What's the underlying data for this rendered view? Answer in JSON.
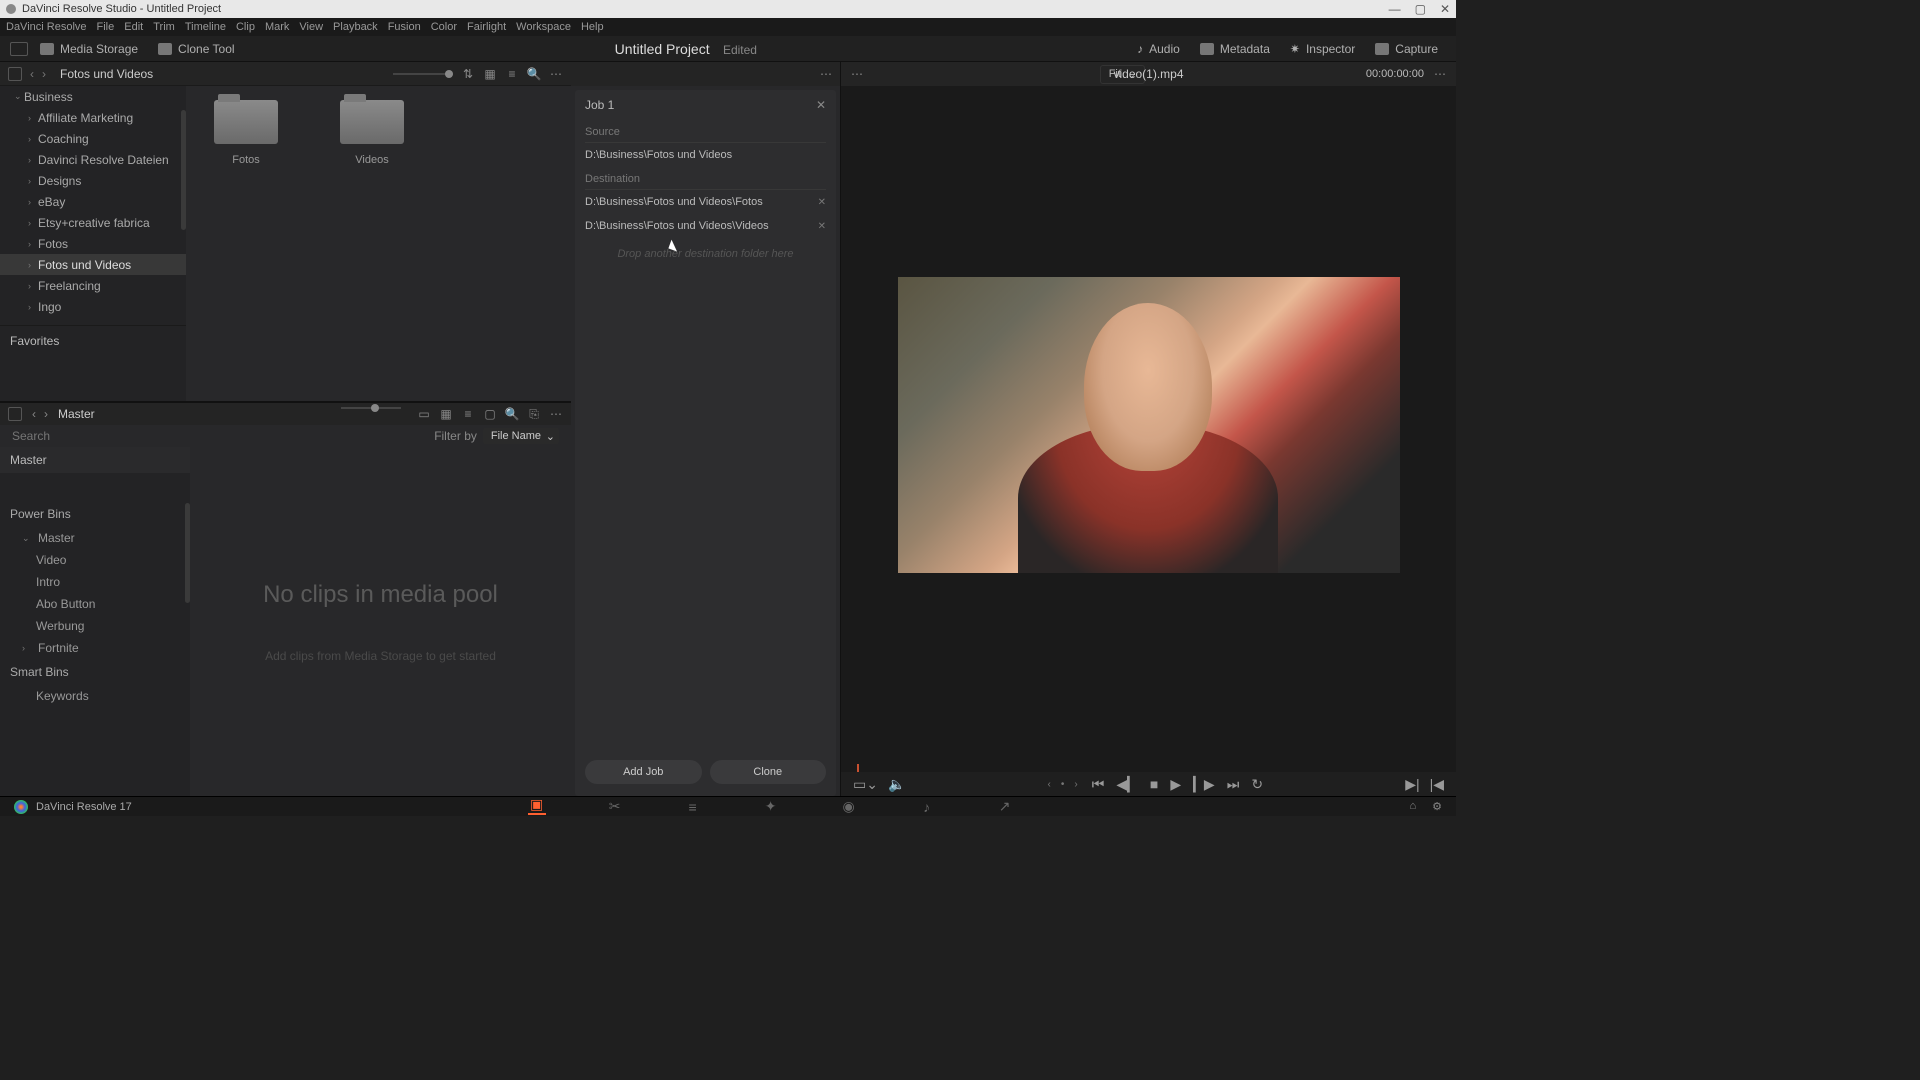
{
  "titlebar": {
    "text": "DaVinci Resolve Studio - Untitled Project"
  },
  "menu": [
    "DaVinci Resolve",
    "File",
    "Edit",
    "Trim",
    "Timeline",
    "Clip",
    "Mark",
    "View",
    "Playback",
    "Fusion",
    "Color",
    "Fairlight",
    "Workspace",
    "Help"
  ],
  "toptools": {
    "mediaStorage": "Media Storage",
    "cloneTool": "Clone Tool",
    "project": "Untitled Project",
    "edited": "Edited",
    "audio": "Audio",
    "metadata": "Metadata",
    "inspector": "Inspector",
    "capture": "Capture"
  },
  "mediaStorage": {
    "path": "Fotos und Videos",
    "tree": {
      "root": "Business",
      "items": [
        "Affiliate Marketing",
        "Coaching",
        "Davinci Resolve Dateien",
        "Designs",
        "eBay",
        "Etsy+creative fabrica",
        "Fotos",
        "Fotos und Videos",
        "Freelancing",
        "Ingo"
      ],
      "active": "Fotos und Videos",
      "favorites": "Favorites"
    },
    "folders": [
      {
        "label": "Fotos"
      },
      {
        "label": "Videos"
      }
    ]
  },
  "cloneJob": {
    "title": "Job 1",
    "sourceLabel": "Source",
    "sourcePath": "D:\\Business\\Fotos und Videos",
    "destLabel": "Destination",
    "dests": [
      "D:\\Business\\Fotos und Videos\\Fotos",
      "D:\\Business\\Fotos und Videos\\Videos"
    ],
    "dropHint": "Drop another destination folder here",
    "addJob": "Add Job",
    "clone": "Clone"
  },
  "viewer": {
    "fit": "Fit",
    "filename": "video(1).mp4",
    "timecode": "00:00:00:00"
  },
  "mediaPool": {
    "breadcrumb": "Master",
    "searchPlaceholder": "Search",
    "filterBy": "Filter by",
    "filterValue": "File Name",
    "masterHdr": "Master",
    "powerBins": "Power Bins",
    "pbMaster": "Master",
    "pbItems": [
      "Video",
      "Intro",
      "Abo Button",
      "Werbung",
      "Fortnite"
    ],
    "smartBins": "Smart Bins",
    "sbItems": [
      "Keywords"
    ],
    "emptyMsg": "No clips in media pool",
    "emptySub": "Add clips from Media Storage to get started"
  },
  "footer": {
    "appName": "DaVinci Resolve 17"
  }
}
